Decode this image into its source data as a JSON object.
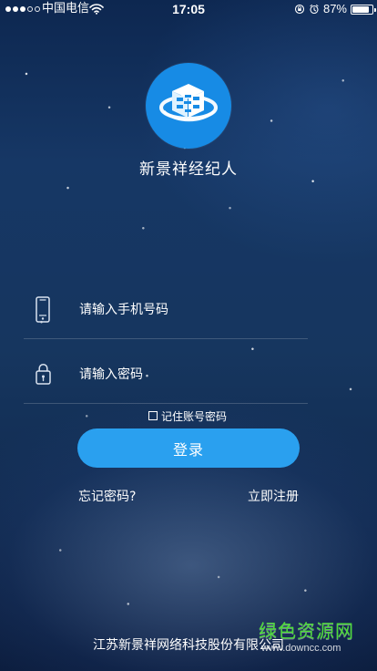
{
  "status_bar": {
    "carrier": "中国电信",
    "time": "17:05",
    "battery_percent": "87%",
    "battery_level": 0.87
  },
  "app": {
    "name": "新景祥经纪人"
  },
  "form": {
    "phone_placeholder": "请输入手机号码",
    "password_placeholder": "请输入密码",
    "remember_label": "记住账号密码",
    "login_label": "登录",
    "forgot_label": "忘记密码?",
    "register_label": "立即注册"
  },
  "footer": {
    "company": "江苏新景祥网络科技股份有限公司"
  },
  "watermark": {
    "brand": "绿色资源网",
    "url": "www.downcc.com"
  },
  "colors": {
    "background_top": "#0d2750",
    "background_bottom": "#0b1c3c",
    "accent": "#2aa0ef",
    "logo_blue": "#178be5"
  },
  "icons": {
    "status_signal": "signal-dots-icon",
    "wifi": "wifi-icon",
    "rotation_lock": "rotation-lock-icon",
    "alarm": "alarm-icon",
    "battery": "battery-icon",
    "phone": "phone-icon",
    "lock": "lock-icon",
    "logo": "app-logo-icon"
  }
}
